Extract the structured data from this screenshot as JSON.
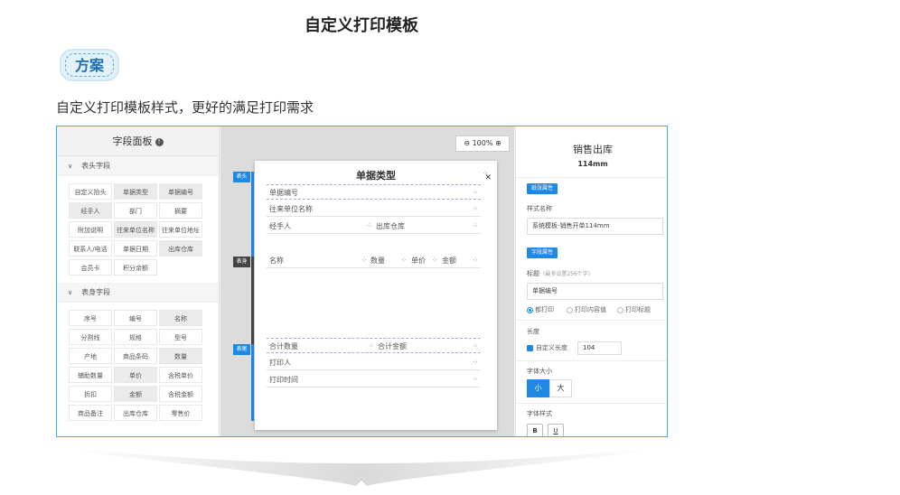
{
  "page": {
    "title": "自定义打印模板",
    "badge": "方案",
    "description": "自定义打印模板样式，更好的满足打印需求"
  },
  "left_panel": {
    "title": "字段面板",
    "sections": [
      {
        "name": "表头字段",
        "items": [
          {
            "label": "自定义抬头",
            "shade": false
          },
          {
            "label": "单据类型",
            "shade": true
          },
          {
            "label": "单据编号",
            "shade": true
          },
          {
            "label": "经手人",
            "shade": true
          },
          {
            "label": "部门",
            "shade": false
          },
          {
            "label": "摘要",
            "shade": false
          },
          {
            "label": "附加说明",
            "shade": false
          },
          {
            "label": "往来单位名称",
            "shade": true
          },
          {
            "label": "往来单位地址",
            "shade": false
          },
          {
            "label": "联系人/电话",
            "shade": false
          },
          {
            "label": "单据日期",
            "shade": false
          },
          {
            "label": "出库仓库",
            "shade": true
          },
          {
            "label": "会员卡",
            "shade": false
          },
          {
            "label": "积分余额",
            "shade": false
          }
        ]
      },
      {
        "name": "表身字段",
        "items": [
          {
            "label": "序号",
            "shade": false
          },
          {
            "label": "编号",
            "shade": false
          },
          {
            "label": "名称",
            "shade": true
          },
          {
            "label": "分割线",
            "shade": false
          },
          {
            "label": "规格",
            "shade": false
          },
          {
            "label": "型号",
            "shade": false
          },
          {
            "label": "产地",
            "shade": false
          },
          {
            "label": "商品条码",
            "shade": false
          },
          {
            "label": "数量",
            "shade": true
          },
          {
            "label": "辅助数量",
            "shade": false
          },
          {
            "label": "单价",
            "shade": true
          },
          {
            "label": "含税单价",
            "shade": false
          },
          {
            "label": "折扣",
            "shade": false
          },
          {
            "label": "金额",
            "shade": true
          },
          {
            "label": "含税金额",
            "shade": false
          },
          {
            "label": "商品备注",
            "shade": false
          },
          {
            "label": "出库仓库",
            "shade": false
          },
          {
            "label": "零售价",
            "shade": false
          }
        ]
      }
    ]
  },
  "center": {
    "zoom": "100%",
    "tags": {
      "header": "表头",
      "body": "表身",
      "footer": "表尾"
    },
    "doc_title": "单据类型",
    "header_rows": [
      "单据编号",
      "往来单位名称"
    ],
    "handler_row": {
      "left": "经手人",
      "right": "出库仓库"
    },
    "body_columns": [
      "名称",
      "数量",
      "单价",
      "金额"
    ],
    "footer_sum": {
      "left": "合计数量",
      "right": "合计金额"
    },
    "footer_rows": [
      "打印人",
      "打印时间"
    ]
  },
  "right_panel": {
    "title": "销售出库",
    "subtitle": "114mm",
    "paper_attr": "纸张属性",
    "style_name_label": "样式名称",
    "style_name_value": "系统模板-销售开单114mm",
    "field_attr": "字段属性",
    "caption_label": "标题",
    "caption_hint": "(最多设置256个字)",
    "caption_value": "单据编号",
    "radio_options": [
      "都打印",
      "打印内容值",
      "打印标题"
    ],
    "length_label": "长度",
    "custom_length": "自定义长度",
    "length_value": "104",
    "font_size_label": "字体大小",
    "font_sizes": [
      "小",
      "大"
    ],
    "font_style_label": "字体样式",
    "font_styles": [
      "B",
      "U"
    ]
  }
}
